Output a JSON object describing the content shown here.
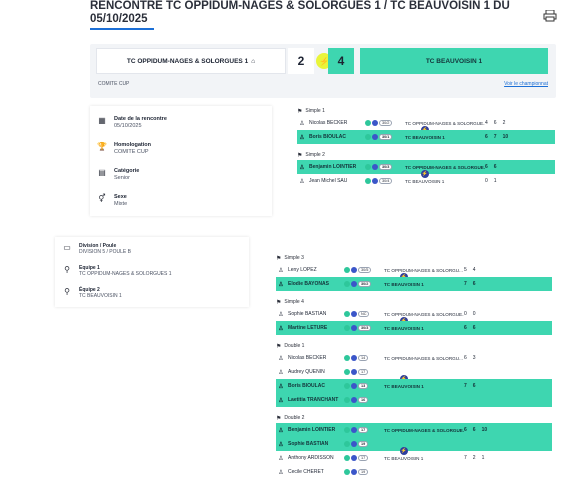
{
  "page": {
    "title": "RENCONTRE TC OPPIDUM-NAGES & SOLORGUES 1 / TC BEAUVOISIN 1 DU 05/10/2025",
    "print_icon": "printer-icon"
  },
  "scoreboard": {
    "home_team": "TC OPPIDUM-NAGES & SOLORGUES 1",
    "away_team": "TC BEAUVOISIN 1",
    "home_score": "2",
    "away_score": "4",
    "competition_label": "COMITE CUP",
    "championship_link": "Voir le championnat",
    "home_icon": "home-icon",
    "flash_icon": "lightning-icon"
  },
  "info": {
    "date_label": "Date de la rencontre",
    "date_value": "05/10/2025",
    "homologation_label": "Homologation",
    "homologation_value": "COMITE CUP",
    "category_label": "Catégorie",
    "category_value": "Senior",
    "sex_label": "Sexe",
    "sex_value": "Mixte"
  },
  "info2": {
    "division_label": "Division / Poule",
    "division_value": "DIVISION 5 / POULE B",
    "team1_label": "Equipe 1",
    "team1_value": "TC OPPIDUM-NAGES & SOLORGUES 1",
    "team2_label": "Équipe 2",
    "team2_value": "TC BEAUVOISIN 1"
  },
  "matches": [
    {
      "title": "Simple 1",
      "rows": [
        {
          "name": "Nicolas BECKER",
          "rank": "30/2",
          "club": "TC OPPIDUM-NAGES & SOLORGUE...",
          "sets": [
            "4",
            "6",
            "2"
          ],
          "win": false
        },
        {
          "name": "Boris BIOULAC",
          "rank": "30/1",
          "club": "TC BEAUVOISIN 1",
          "sets": [
            "6",
            "7",
            "10"
          ],
          "win": true
        }
      ]
    },
    {
      "title": "Simple 2",
      "rows": [
        {
          "name": "Benjamin LOINTIER",
          "rank": "30/3",
          "club": "TC OPPIDUM-NAGES & SOLORGUE...",
          "sets": [
            "6",
            "6"
          ],
          "win": true
        },
        {
          "name": "Jean Michel SAU",
          "rank": "30/4",
          "club": "TC BEAUVOISIN 1",
          "sets": [
            "0",
            "1"
          ],
          "win": false
        }
      ]
    },
    {
      "title": "Simple 3",
      "rows": [
        {
          "name": "Leny LOPEZ",
          "rank": "30/5",
          "club": "TC OPPIDUM-NAGES & SOLORGU...",
          "sets": [
            "5",
            "4"
          ],
          "win": false
        },
        {
          "name": "Elodie BAYONAS",
          "rank": "30/2",
          "club": "TC BEAUVOISIN 1",
          "sets": [
            "7",
            "6"
          ],
          "win": true
        }
      ]
    },
    {
      "title": "Simple 4",
      "rows": [
        {
          "name": "Sophie BASTIAN",
          "rank": "NC",
          "club": "TC OPPIDUM-NAGES & SOLORGUE...",
          "sets": [
            "0",
            "0"
          ],
          "win": false
        },
        {
          "name": "Martine LETURE",
          "rank": "30/3",
          "club": "TC BEAUVOISIN 1",
          "sets": [
            "6",
            "6"
          ],
          "win": true
        }
      ]
    },
    {
      "title": "Double 1",
      "rows": [
        {
          "name": "Nicolas BECKER",
          "rank": "14",
          "club": "TC OPPIDUM-NAGES & SOLORGU...",
          "sets": [
            "6",
            "3"
          ],
          "win": false
        },
        {
          "name": "Audrey QUENIN",
          "rank": "17",
          "club": "",
          "sets": [],
          "win": false
        },
        {
          "name": "Boris BIOULAC",
          "rank": "13",
          "club": "TC BEAUVOISIN 1",
          "sets": [
            "7",
            "6"
          ],
          "win": true
        },
        {
          "name": "Laetitia TRANCHANT",
          "rank": "16",
          "club": "",
          "sets": [],
          "win": true
        }
      ]
    },
    {
      "title": "Double 2",
      "rows": [
        {
          "name": "Benjamin LOINTIER",
          "rank": "17",
          "club": "TC OPPIDUM-NAGES & SOLORGUE...",
          "sets": [
            "6",
            "6",
            "10"
          ],
          "win": true
        },
        {
          "name": "Sophie BASTIAN",
          "rank": "19",
          "club": "",
          "sets": [],
          "win": true
        },
        {
          "name": "Anthony ARDISSON",
          "rank": "17",
          "club": "TC BEAUVOISIN 1",
          "sets": [
            "7",
            "2",
            "1"
          ],
          "win": false
        },
        {
          "name": "Cecile CHERET",
          "rank": "19",
          "club": "",
          "sets": [],
          "win": false
        }
      ]
    }
  ]
}
